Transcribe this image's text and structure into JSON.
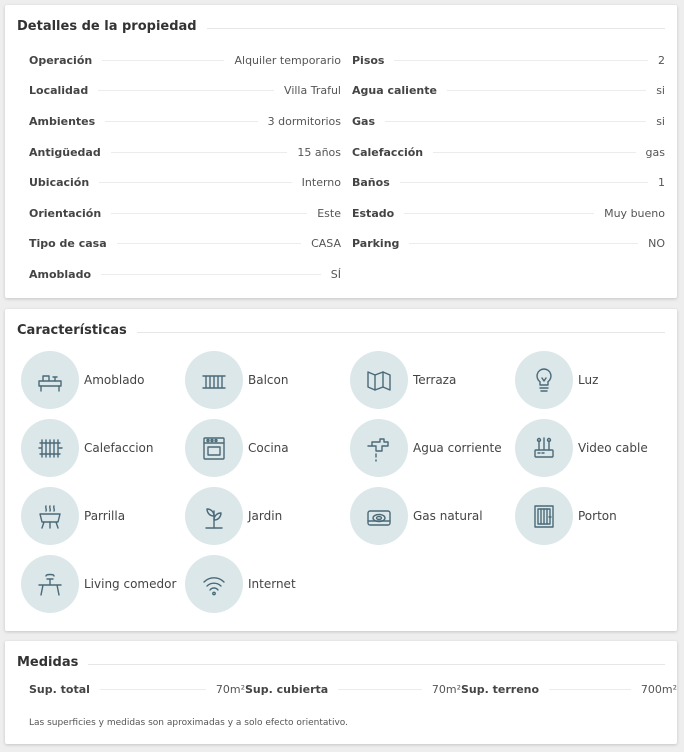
{
  "details": {
    "title": "Detalles de la propiedad",
    "left": [
      {
        "key": "Operación",
        "value": "Alquiler temporario"
      },
      {
        "key": "Localidad",
        "value": "Villa Traful"
      },
      {
        "key": "Ambientes",
        "value": "3 dormitorios"
      },
      {
        "key": "Antigüedad",
        "value": "15 años"
      },
      {
        "key": "Ubicación",
        "value": "Interno"
      },
      {
        "key": "Orientación",
        "value": "Este"
      },
      {
        "key": "Tipo de casa",
        "value": "CASA"
      },
      {
        "key": "Amoblado",
        "value": "SÍ"
      }
    ],
    "right": [
      {
        "key": "Pisos",
        "value": "2"
      },
      {
        "key": "Agua caliente",
        "value": "si"
      },
      {
        "key": "Gas",
        "value": "si"
      },
      {
        "key": "Calefacción",
        "value": "gas"
      },
      {
        "key": "Baños",
        "value": "1"
      },
      {
        "key": "Estado",
        "value": "Muy bueno"
      },
      {
        "key": "Parking",
        "value": "NO"
      }
    ]
  },
  "features": {
    "title": "Características",
    "items": [
      {
        "label": "Amoblado",
        "icon": "furniture-icon"
      },
      {
        "label": "Balcon",
        "icon": "balcony-icon"
      },
      {
        "label": "Terraza",
        "icon": "terrace-icon"
      },
      {
        "label": "Luz",
        "icon": "lightbulb-icon"
      },
      {
        "label": "Calefaccion",
        "icon": "radiator-icon"
      },
      {
        "label": "Cocina",
        "icon": "stove-icon"
      },
      {
        "label": "Agua corriente",
        "icon": "faucet-icon"
      },
      {
        "label": "Video cable",
        "icon": "cable-icon"
      },
      {
        "label": "Parrilla",
        "icon": "grill-icon"
      },
      {
        "label": "Jardin",
        "icon": "plant-icon"
      },
      {
        "label": "Gas natural",
        "icon": "gas-burner-icon"
      },
      {
        "label": "Porton",
        "icon": "gate-icon"
      },
      {
        "label": "Living comedor",
        "icon": "dining-table-icon"
      },
      {
        "label": "Internet",
        "icon": "wifi-icon"
      }
    ]
  },
  "measures": {
    "title": "Medidas",
    "items": [
      {
        "key": "Sup. total",
        "value": "70m²"
      },
      {
        "key": "Sup. cubierta",
        "value": "70m²"
      },
      {
        "key": "Sup. terreno",
        "value": "700m²"
      }
    ],
    "note": "Las superficies y medidas son aproximadas y a solo efecto orientativo."
  },
  "colors": {
    "icon_bg": "#dce7ea",
    "icon_stroke": "#4a6a78"
  }
}
